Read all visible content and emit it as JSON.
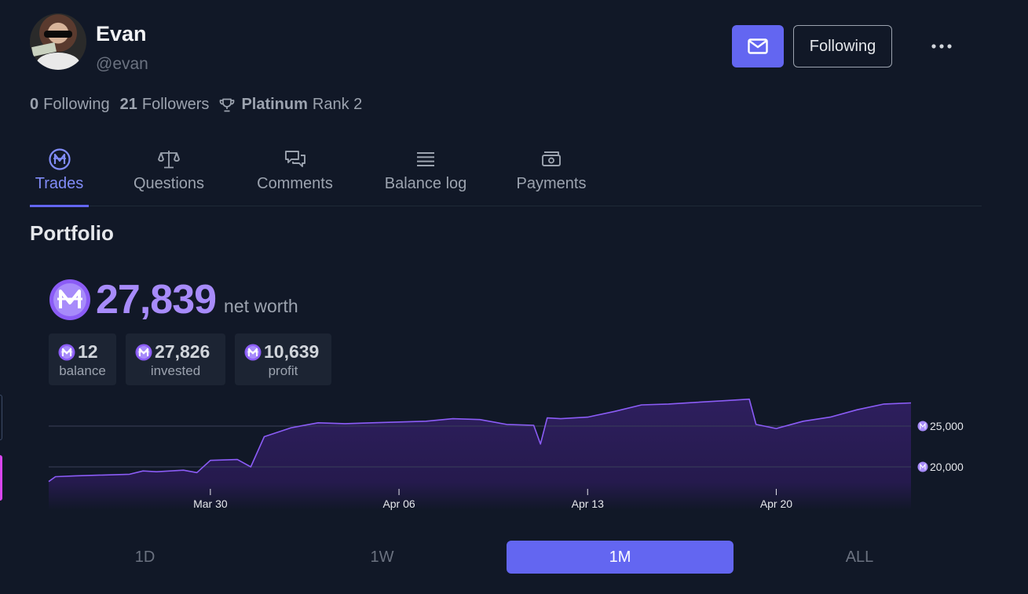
{
  "profile": {
    "name": "Evan",
    "handle": "@evan",
    "following_count": "0",
    "following_label": "Following",
    "followers_count": "21",
    "followers_label": "Followers",
    "rank_league": "Platinum",
    "rank_label": "Rank 2"
  },
  "actions": {
    "message_icon": "envelope-icon",
    "follow_label": "Following",
    "more_icon": "ellipsis-icon"
  },
  "tabs": [
    {
      "label": "Trades",
      "icon": "mana-coin-icon",
      "active": true
    },
    {
      "label": "Questions",
      "icon": "scale-icon",
      "active": false
    },
    {
      "label": "Comments",
      "icon": "chat-bubbles-icon",
      "active": false
    },
    {
      "label": "Balance log",
      "icon": "list-lines-icon",
      "active": false
    },
    {
      "label": "Payments",
      "icon": "cash-icon",
      "active": false
    }
  ],
  "portfolio": {
    "title": "Portfolio",
    "net_worth": "27,839",
    "net_worth_label": "net worth",
    "cards": [
      {
        "value": "12",
        "label": "balance"
      },
      {
        "value": "27,826",
        "label": "invested"
      },
      {
        "value": "10,639",
        "label": "profit"
      }
    ]
  },
  "colors": {
    "background": "#111827",
    "accent": "#6366f1",
    "mana": "#a78bfa",
    "line": "#8b5cf6"
  },
  "chart_data": {
    "type": "area",
    "x_ticks": [
      "Mar 30",
      "Apr 06",
      "Apr 13",
      "Apr 20"
    ],
    "y_ticks": [
      "25,000",
      "20,000"
    ],
    "ylim": [
      17000,
      29000
    ],
    "grid": true,
    "series": [
      {
        "points": [
          [
            "2024-03-24",
            18200
          ],
          [
            "2024-03-24 06",
            18800
          ],
          [
            "2024-03-25",
            18900
          ],
          [
            "2024-03-26",
            19000
          ],
          [
            "2024-03-27",
            19100
          ],
          [
            "2024-03-27 12",
            19500
          ],
          [
            "2024-03-28",
            19400
          ],
          [
            "2024-03-29",
            19600
          ],
          [
            "2024-03-29 12",
            19300
          ],
          [
            "2024-03-30",
            20800
          ],
          [
            "2024-03-31",
            20900
          ],
          [
            "2024-03-31 12",
            20000
          ],
          [
            "2024-04-01",
            23700
          ],
          [
            "2024-04-02",
            24800
          ],
          [
            "2024-04-03",
            25400
          ],
          [
            "2024-04-04",
            25300
          ],
          [
            "2024-04-05",
            25400
          ],
          [
            "2024-04-06",
            25500
          ],
          [
            "2024-04-07",
            25600
          ],
          [
            "2024-04-08",
            25900
          ],
          [
            "2024-04-09",
            25800
          ],
          [
            "2024-04-10",
            25200
          ],
          [
            "2024-04-11",
            25100
          ],
          [
            "2024-04-11 06",
            22800
          ],
          [
            "2024-04-11 12",
            26000
          ],
          [
            "2024-04-12",
            25900
          ],
          [
            "2024-04-13",
            26100
          ],
          [
            "2024-04-14",
            26800
          ],
          [
            "2024-04-15",
            27600
          ],
          [
            "2024-04-16",
            27700
          ],
          [
            "2024-04-17",
            27900
          ],
          [
            "2024-04-18",
            28100
          ],
          [
            "2024-04-19",
            28300
          ],
          [
            "2024-04-19 06",
            25200
          ],
          [
            "2024-04-20",
            24700
          ],
          [
            "2024-04-21",
            25600
          ],
          [
            "2024-04-22",
            26100
          ],
          [
            "2024-04-23",
            27000
          ],
          [
            "2024-04-24",
            27700
          ],
          [
            "2024-04-25",
            27839
          ]
        ]
      }
    ]
  },
  "ranges": [
    {
      "label": "1D",
      "active": false
    },
    {
      "label": "1W",
      "active": false
    },
    {
      "label": "1M",
      "active": true
    },
    {
      "label": "ALL",
      "active": false
    }
  ]
}
